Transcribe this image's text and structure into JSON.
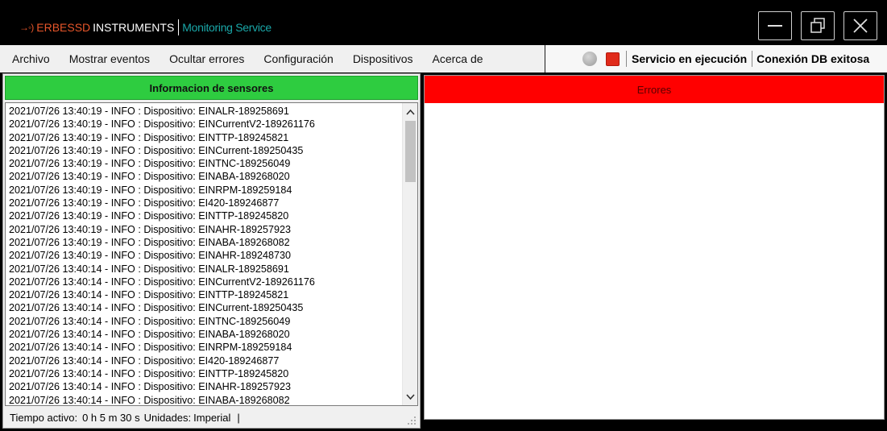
{
  "titlebar": {
    "logo_glyph": "→◦)",
    "brand_part1": "ERBESSD",
    "brand_part2": "INSTRUMENTS",
    "service": "Monitoring Service"
  },
  "menu": {
    "items": [
      "Archivo",
      "Mostrar eventos",
      "Ocultar errores",
      "Configuración",
      "Dispositivos",
      "Acerca de"
    ]
  },
  "status": {
    "service_status": "Servicio en ejecución",
    "db_status": "Conexión DB exitosa",
    "indicator_gray": "#b0b0b0",
    "indicator_red": "#e02a1a"
  },
  "sensors_panel": {
    "header": "Informacion de sensores",
    "header_color": "#2ecc40",
    "log": [
      "2021/07/26 13:40:19 - INFO : Dispositivo: EINALR-189258691",
      "2021/07/26 13:40:19 - INFO : Dispositivo: EINCurrentV2-189261176",
      "2021/07/26 13:40:19 - INFO : Dispositivo: EINTTP-189245821",
      "2021/07/26 13:40:19 - INFO : Dispositivo: EINCurrent-189250435",
      "2021/07/26 13:40:19 - INFO : Dispositivo: EINTNC-189256049",
      "2021/07/26 13:40:19 - INFO : Dispositivo: EINABA-189268020",
      "2021/07/26 13:40:19 - INFO : Dispositivo: EINRPM-189259184",
      "2021/07/26 13:40:19 - INFO : Dispositivo: EI420-189246877",
      "2021/07/26 13:40:19 - INFO : Dispositivo: EINTTP-189245820",
      "2021/07/26 13:40:19 - INFO : Dispositivo: EINAHR-189257923",
      "2021/07/26 13:40:19 - INFO : Dispositivo: EINABA-189268082",
      "2021/07/26 13:40:19 - INFO : Dispositivo: EINAHR-189248730",
      "2021/07/26 13:40:14 - INFO : Dispositivo: EINALR-189258691",
      "2021/07/26 13:40:14 - INFO : Dispositivo: EINCurrentV2-189261176",
      "2021/07/26 13:40:14 - INFO : Dispositivo: EINTTP-189245821",
      "2021/07/26 13:40:14 - INFO : Dispositivo: EINCurrent-189250435",
      "2021/07/26 13:40:14 - INFO : Dispositivo: EINTNC-189256049",
      "2021/07/26 13:40:14 - INFO : Dispositivo: EINABA-189268020",
      "2021/07/26 13:40:14 - INFO : Dispositivo: EINRPM-189259184",
      "2021/07/26 13:40:14 - INFO : Dispositivo: EI420-189246877",
      "2021/07/26 13:40:14 - INFO : Dispositivo: EINTTP-189245820",
      "2021/07/26 13:40:14 - INFO : Dispositivo: EINAHR-189257923",
      "2021/07/26 13:40:14 - INFO : Dispositivo: EINABA-189268082"
    ],
    "footer": {
      "uptime_label": "Tiempo activo:",
      "uptime_value": "0 h 5 m 30 s",
      "units_label": "Unidades:",
      "units_value": "Imperial",
      "separator": "|"
    }
  },
  "errors_panel": {
    "header": "Errores",
    "header_color": "#ff0000"
  }
}
